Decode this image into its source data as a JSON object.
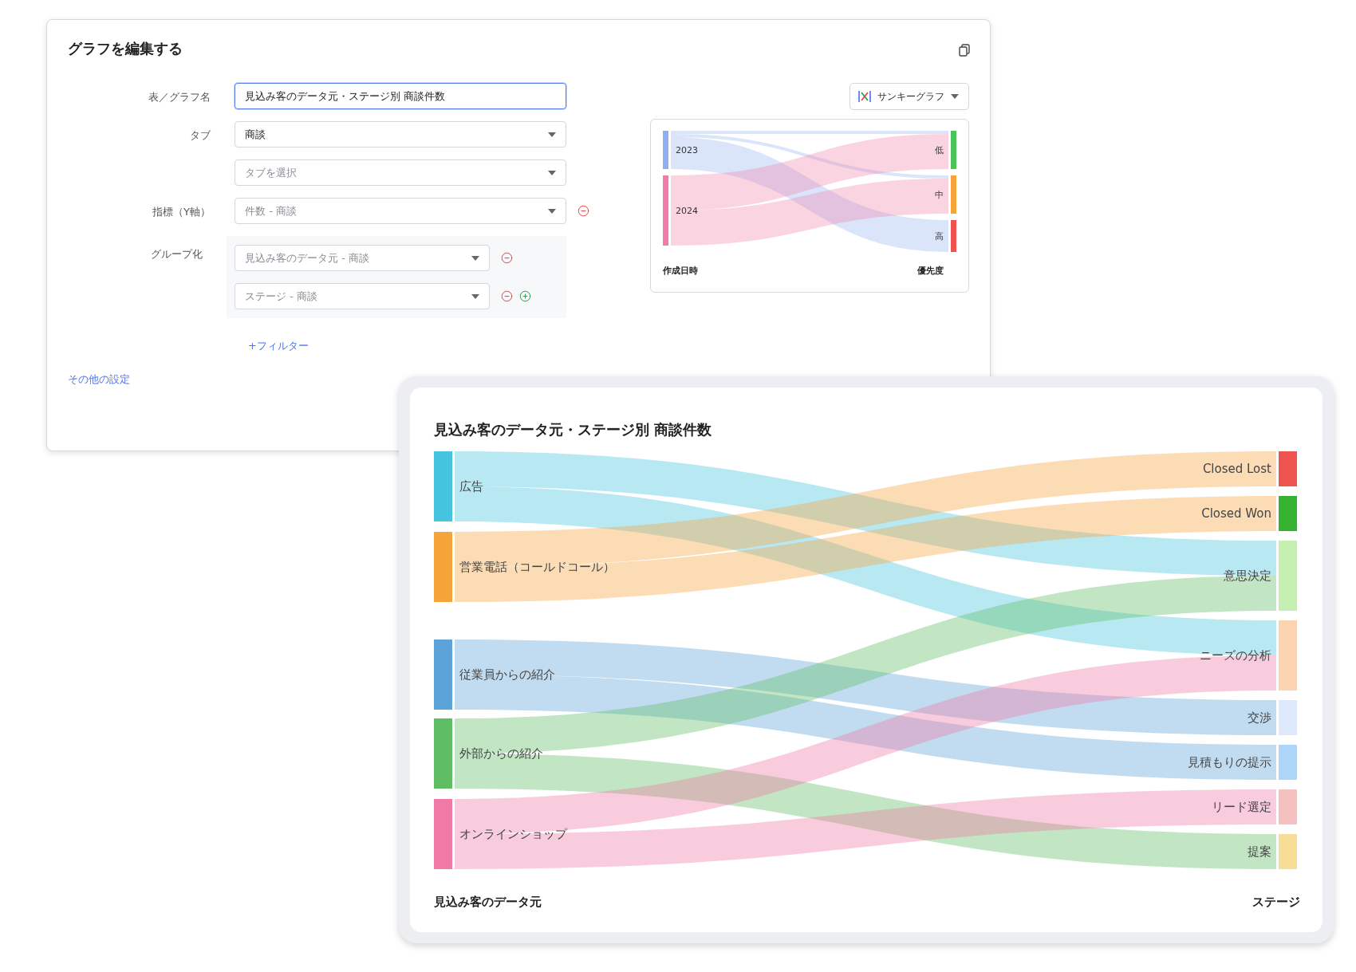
{
  "editor": {
    "title": "グラフを編集する",
    "fields": [
      {
        "kind": "text",
        "label": "表／グラフ名",
        "value": "見込み客のデータ元・ステージ別 商談件数",
        "focused": true,
        "removable": false
      },
      {
        "kind": "select",
        "label": "タブ",
        "value": "商談",
        "focused": false,
        "removable": false
      },
      {
        "kind": "select",
        "placeholder": "タブを選択",
        "focused": false,
        "removable": false
      },
      {
        "kind": "select",
        "label": "指標（Y軸）",
        "placeholder": "件数 - 商談",
        "focused": false,
        "removable": true
      }
    ],
    "grouping": {
      "label": "グループ化",
      "items": [
        {
          "placeholder": "見込み客のデータ元 - 商談",
          "removable": true,
          "addable": false
        },
        {
          "placeholder": "ステージ - 商談",
          "removable": true,
          "addable": true
        }
      ]
    },
    "filter_link": "+フィルター",
    "more_settings_link": "その他の設定"
  },
  "preview": {
    "chart_type": "サンキーグラフ",
    "sources": [
      {
        "label": "2023",
        "color": "#8fb0f0"
      },
      {
        "label": "2024",
        "color": "#f27ba8"
      }
    ],
    "targets": [
      {
        "label": "低",
        "color": "#4cc359"
      },
      {
        "label": "中",
        "color": "#f6a43a"
      },
      {
        "label": "高",
        "color": "#ef5350"
      }
    ],
    "source_axis": "作成日時",
    "target_axis": "優先度"
  },
  "chart_card": {
    "title": "見込み客のデータ元・ステージ別 商談件数",
    "sources": [
      {
        "label": "広告",
        "color": "#45c4e0"
      },
      {
        "label": "営業電話（コールドコール）",
        "color": "#f6a43a"
      },
      {
        "label": "従業員からの紹介",
        "color": "#5ca3d9"
      },
      {
        "label": "外部からの紹介",
        "color": "#5fbd63"
      },
      {
        "label": "オンラインショップ",
        "color": "#f07aa6"
      }
    ],
    "targets": [
      {
        "label": "Closed Lost",
        "color": "#ef5350"
      },
      {
        "label": "Closed Won",
        "color": "#35b22f"
      },
      {
        "label": "意思決定",
        "color": "#c5efb0"
      },
      {
        "label": "ニーズの分析",
        "color": "#fbd3b0"
      },
      {
        "label": "交渉",
        "color": "#dde9fb"
      },
      {
        "label": "見積もりの提示",
        "color": "#aed6fb"
      },
      {
        "label": "リード選定",
        "color": "#f7c0c0"
      },
      {
        "label": "提案",
        "color": "#f7de96"
      }
    ],
    "source_axis": "見込み客のデータ元",
    "target_axis": "ステージ"
  }
}
